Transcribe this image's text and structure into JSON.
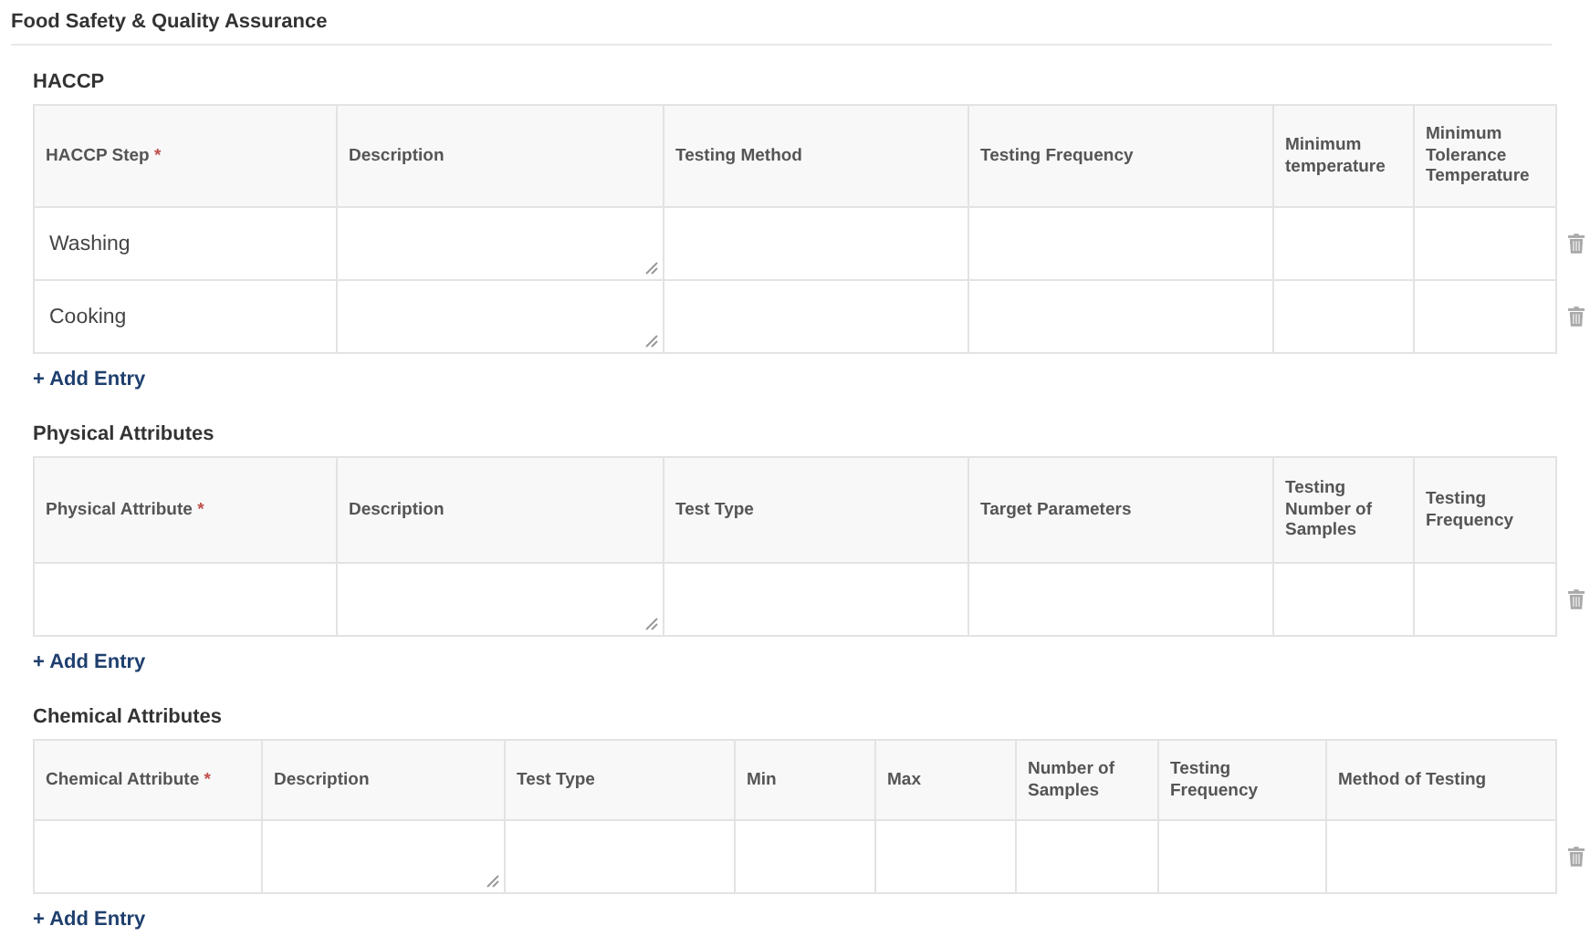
{
  "page_title": "Food Safety & Quality Assurance",
  "sections": [
    {
      "title": "HACCP",
      "columns": [
        {
          "label": "HACCP Step",
          "required": true,
          "kind": "text"
        },
        {
          "label": "Description",
          "required": false,
          "kind": "textarea"
        },
        {
          "label": "Testing Method",
          "required": false,
          "kind": "text"
        },
        {
          "label": "Testing Frequency",
          "required": false,
          "kind": "text"
        },
        {
          "label": "Minimum temperature",
          "required": false,
          "kind": "text"
        },
        {
          "label": "Minimum Tolerance Temperature",
          "required": false,
          "kind": "text"
        }
      ],
      "rows": [
        {
          "value": "Washing",
          "deletable": true
        },
        {
          "value": "Cooking",
          "deletable": true
        }
      ],
      "add_label": "+ Add Entry"
    },
    {
      "title": "Physical Attributes",
      "columns": [
        {
          "label": "Physical Attribute",
          "required": true,
          "kind": "text"
        },
        {
          "label": "Description",
          "required": false,
          "kind": "textarea"
        },
        {
          "label": "Test Type",
          "required": false,
          "kind": "text"
        },
        {
          "label": "Target Parameters",
          "required": false,
          "kind": "text"
        },
        {
          "label": "Testing Number of Samples",
          "required": false,
          "kind": "text"
        },
        {
          "label": "Testing Frequency",
          "required": false,
          "kind": "text"
        }
      ],
      "rows": [
        {
          "deletable": true
        }
      ],
      "add_label": "+ Add Entry"
    },
    {
      "title": "Chemical Attributes",
      "columns": [
        {
          "label": "Chemical Attribute",
          "required": true,
          "kind": "text"
        },
        {
          "label": "Description",
          "required": false,
          "kind": "textarea"
        },
        {
          "label": "Test Type",
          "required": false,
          "kind": "text"
        },
        {
          "label": "Min",
          "required": false,
          "kind": "text"
        },
        {
          "label": "Max",
          "required": false,
          "kind": "text"
        },
        {
          "label": "Number of Samples",
          "required": false,
          "kind": "text"
        },
        {
          "label": "Testing Frequency",
          "required": false,
          "kind": "text"
        },
        {
          "label": "Method of Testing",
          "required": false,
          "kind": "text"
        }
      ],
      "rows": [
        {
          "deletable": true
        }
      ],
      "add_label": "+ Add Entry"
    }
  ],
  "required_mark": "*"
}
